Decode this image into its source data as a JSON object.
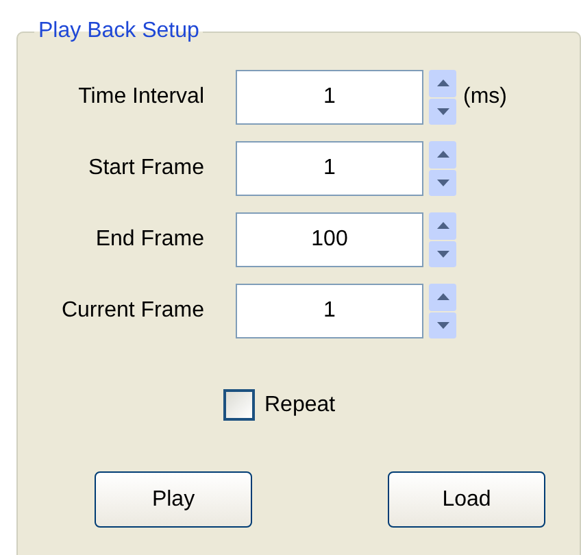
{
  "group": {
    "title": "Play Back Setup"
  },
  "fields": [
    {
      "label": "Time Interval",
      "value": "1",
      "unit": "(ms)"
    },
    {
      "label": "Start Frame",
      "value": "1"
    },
    {
      "label": "End Frame",
      "value": "100"
    },
    {
      "label": "Current Frame",
      "value": "1"
    }
  ],
  "repeat": {
    "label": "Repeat",
    "checked": false
  },
  "buttons": [
    "Play",
    "Load"
  ]
}
